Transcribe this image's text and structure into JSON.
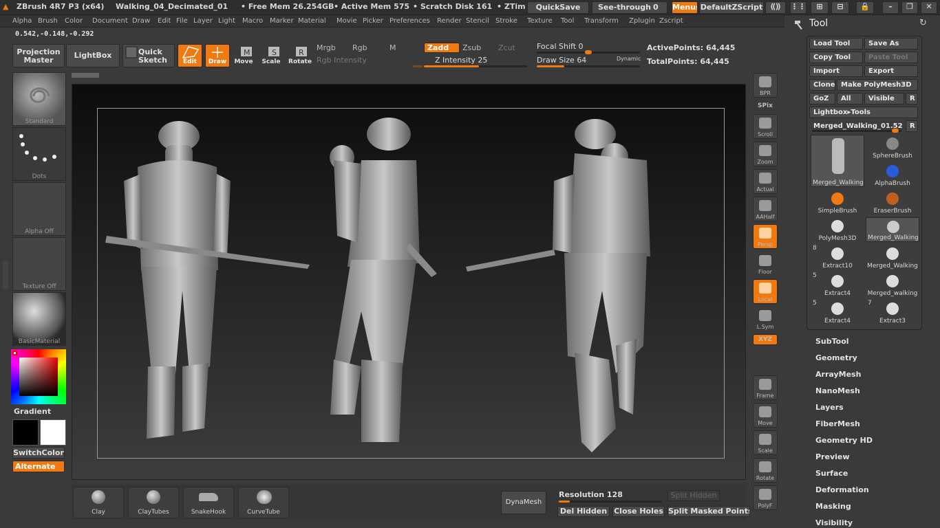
{
  "titlebar": {
    "app": "ZBrush 4R7 P3 (x64)",
    "document": "Walking_04_Decimated_01",
    "free_mem": "• Free Mem 26.254GB",
    "active_mem": "• Active Mem 575",
    "scratch": "• Scratch Disk 161",
    "ztime": "• ZTim",
    "quicksave": "QuickSave",
    "see_through": "See-through",
    "see_through_value": "0",
    "menus": "Menus",
    "script": "DefaultZScript"
  },
  "menu": [
    "Alpha",
    "Brush",
    "Color",
    "Document",
    "Draw",
    "Edit",
    "File",
    "Layer",
    "Light",
    "Macro",
    "Marker",
    "Material",
    "Movie",
    "Picker",
    "Preferences",
    "Render",
    "Stencil",
    "Stroke",
    "Texture",
    "Tool",
    "Transform",
    "Zplugin",
    "Zscript"
  ],
  "coords": "0.542,-0.148,-0.292",
  "toolbar": {
    "projection_master": [
      "Projection",
      "Master"
    ],
    "lightbox": "LightBox",
    "quick_sketch": [
      "Quick",
      "Sketch"
    ],
    "edit": "Edit",
    "draw": "Draw",
    "move": "Move",
    "scale": "Scale",
    "rotate": "Rotate",
    "mrgb": "Mrgb",
    "rgb": "Rgb",
    "m": "M",
    "zadd": "Zadd",
    "zsub": "Zsub",
    "zcut": "Zcut",
    "rgb_intensity": "Rgb Intensity",
    "z_intensity_label": "Z Intensity",
    "z_intensity": "25",
    "focal_shift_label": "Focal Shift",
    "focal_shift": "0",
    "draw_size_label": "Draw Size",
    "draw_size": "64",
    "dynamic": "Dynamic",
    "active_points_label": "ActivePoints:",
    "active_points": "64,445",
    "total_points_label": "TotalPoints:",
    "total_points": "64,445"
  },
  "left": {
    "brush": "Standard",
    "stroke": "Dots",
    "alpha": "Alpha Off",
    "texture": "Texture Off",
    "material": "BasicMaterial",
    "gradient": "Gradient",
    "switch_color": "SwitchColor",
    "alternate": "Alternate"
  },
  "right_tools": [
    "BPR",
    "SPix",
    "Scroll",
    "Zoom",
    "Actual",
    "AAHalf",
    "Persp",
    "Floor",
    "Local",
    "L.Sym",
    "XYZ",
    "Frame",
    "Move",
    "Scale",
    "Rotate",
    "PolyF"
  ],
  "tool_panel": {
    "title": "Tool",
    "load_tool": "Load Tool",
    "save_as": "Save As",
    "copy_tool": "Copy Tool",
    "paste_tool": "Paste Tool",
    "import": "Import",
    "export": "Export",
    "clone": "Clone",
    "make_polymesh": "Make PolyMesh3D",
    "goz": "GoZ",
    "all": "All",
    "visible": "Visible",
    "r": "R",
    "lightbox_tools": "Lightbox▸Tools",
    "current_tool": "Merged_Walking_01.52",
    "thumbs": [
      "Merged_Walking",
      "SphereBrush",
      "AlphaBrush",
      "SimpleBrush",
      "EraserBrush",
      "PolyMesh3D",
      "Merged_Walking",
      "Extract10",
      "Merged_Walking",
      "Extract4",
      "Merged_walking",
      "Extract4",
      "Extract3"
    ],
    "counts": [
      "8",
      "5",
      "5",
      "7"
    ]
  },
  "sections": [
    "SubTool",
    "Geometry",
    "ArrayMesh",
    "NanoMesh",
    "Layers",
    "FiberMesh",
    "Geometry HD",
    "Preview",
    "Surface",
    "Deformation",
    "Masking",
    "Visibility"
  ],
  "bottom": {
    "brushes": [
      "Clay",
      "ClayTubes",
      "SnakeHook",
      "CurveTube"
    ],
    "dynamesh": "DynaMesh",
    "resolution_label": "Resolution",
    "resolution": "128",
    "split_hidden": "Split Hidden",
    "del_hidden": "Del Hidden",
    "close_holes": "Close Holes",
    "split_masked": "Split Masked Points"
  },
  "colors": {
    "accent": "#f07a10",
    "panel": "#3a3a3a",
    "primary_color": "#000000",
    "secondary_color": "#ffffff"
  }
}
